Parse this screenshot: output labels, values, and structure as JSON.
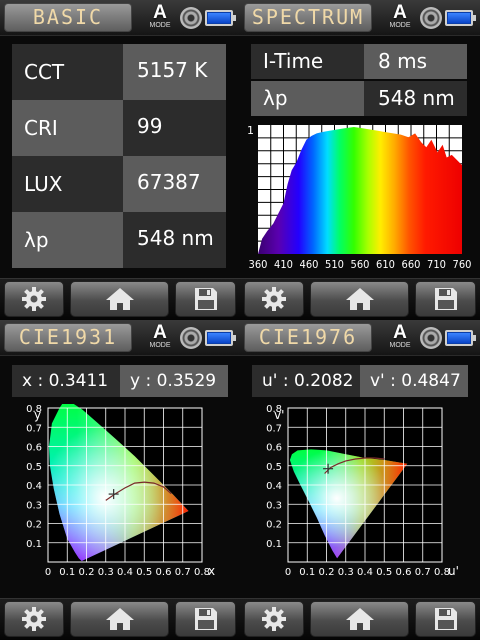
{
  "colors": {
    "bg": "#000000",
    "title_text": "#f0d9a8",
    "cell_dark": "#2c2c2c",
    "cell_light": "#5c5c5c",
    "battery": "#0a45c8"
  },
  "mode": {
    "letter": "A",
    "label": "MODE"
  },
  "icons": [
    "camera-icon",
    "battery-icon",
    "gear-icon",
    "home-icon",
    "save-icon"
  ],
  "basic": {
    "title": "BASIC",
    "rows": [
      {
        "label": "CCT",
        "value": "5157 K"
      },
      {
        "label": "CRI",
        "value": "99"
      },
      {
        "label": "LUX",
        "value": "67387"
      },
      {
        "label": "λp",
        "value": "548 nm"
      }
    ]
  },
  "spectrum": {
    "title": "SPECTRUM",
    "rows": [
      {
        "label": "I-Time",
        "value": "8 ms"
      },
      {
        "label": "λp",
        "value": "548 nm"
      }
    ],
    "y_tick": "1",
    "x_ticks": [
      "360",
      "410",
      "460",
      "510",
      "560",
      "610",
      "660",
      "710",
      "760"
    ]
  },
  "cie1931": {
    "title": "CIE1931",
    "x_label": "x",
    "x_value": ": 0.3411",
    "y_label": "y",
    "y_value": ": 0.3529",
    "axis_x": "x",
    "axis_y": "y",
    "x_ticks": [
      "0",
      "0.1",
      "0.2",
      "0.3",
      "0.4",
      "0.5",
      "0.6",
      "0.7",
      "0.8"
    ],
    "y_ticks": [
      "0.8",
      "0.7",
      "0.6",
      "0.5",
      "0.4",
      "0.3",
      "0.2",
      "0.1"
    ],
    "point": {
      "x": 0.3411,
      "y": 0.3529
    }
  },
  "cie1976": {
    "title": "CIE1976",
    "u_label": "u'",
    "u_value": ": 0.2082",
    "v_label": "v'",
    "v_value": ": 0.4847",
    "axis_x": "u'",
    "axis_y": "v'",
    "x_ticks": [
      "0",
      "0.1",
      "0.2",
      "0.3",
      "0.4",
      "0.5",
      "0.6",
      "0.7",
      "0.8"
    ],
    "y_ticks": [
      "0.8",
      "0.7",
      "0.6",
      "0.5",
      "0.4",
      "0.3",
      "0.2",
      "0.1"
    ],
    "point": {
      "x": 0.2082,
      "y": 0.4847
    }
  }
}
